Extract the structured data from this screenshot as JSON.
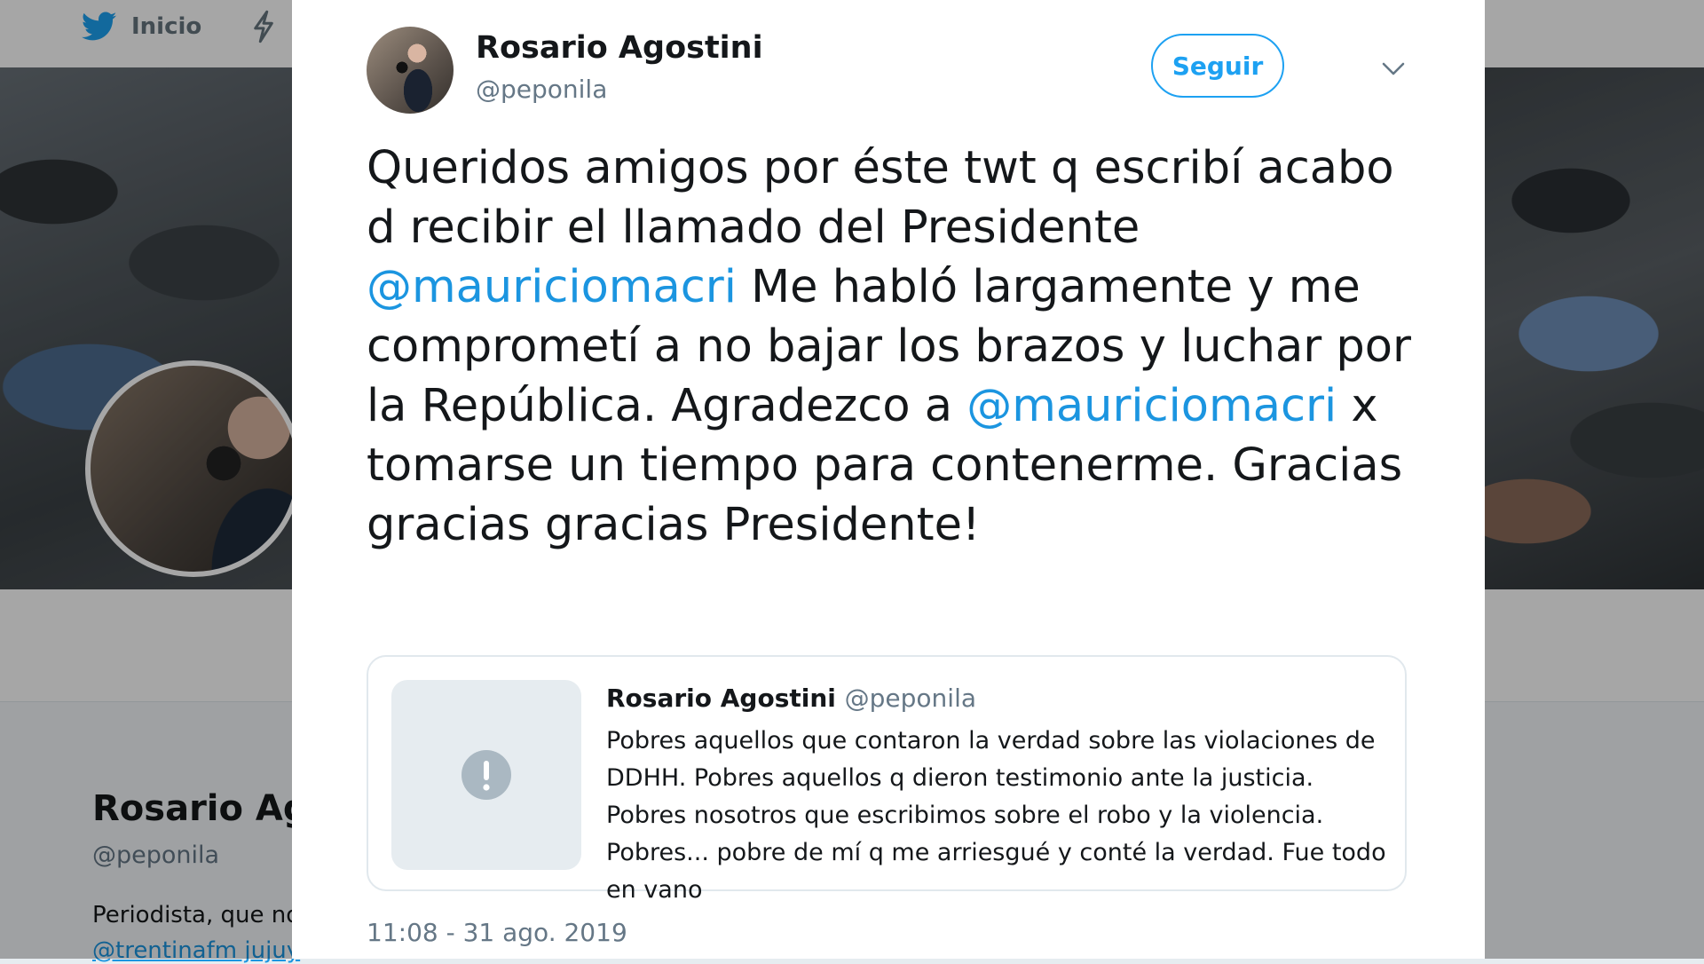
{
  "background_page": {
    "nav": {
      "home_label": "Inicio"
    },
    "profile": {
      "name": "Rosario Ag",
      "handle": "@peponila",
      "bio": "Periodista, que no",
      "link": "@trentinafm jujuy"
    }
  },
  "tweet": {
    "author": {
      "name": "Rosario Agostini",
      "handle": "@peponila"
    },
    "follow_label": "Seguir",
    "text_parts": [
      "Queridos amigos por éste twt q escribí acabo d recibir el llamado del Presidente ",
      "@mauriciomacri",
      " Me habló largamente y me comprometí a no bajar los brazos y luchar por la República. Agradezco a ",
      "@mauriciomacri",
      " x tomarse un tiempo para contenerme. Gracias gracias gracias Presidente!"
    ],
    "quoted": {
      "name": "Rosario Agostini",
      "handle": "@peponila",
      "text": "Pobres aquellos que contaron la verdad sobre las violaciones de DDHH. Pobres aquellos q dieron testimonio ante la justicia. Pobres nosotros que escribimos sobre el robo y la violencia. Pobres... pobre de mí q me arriesgué y conté la verdad. Fue todo en vano"
    },
    "timestamp": "11:08 - 31 ago. 2019"
  },
  "colors": {
    "accent": "#1da1f2",
    "link": "#1b95e0",
    "text": "#14171a",
    "secondary": "#657786"
  },
  "icons": [
    "twitter-bird-icon",
    "lightning-icon",
    "chevron-down-icon",
    "alert-icon"
  ]
}
